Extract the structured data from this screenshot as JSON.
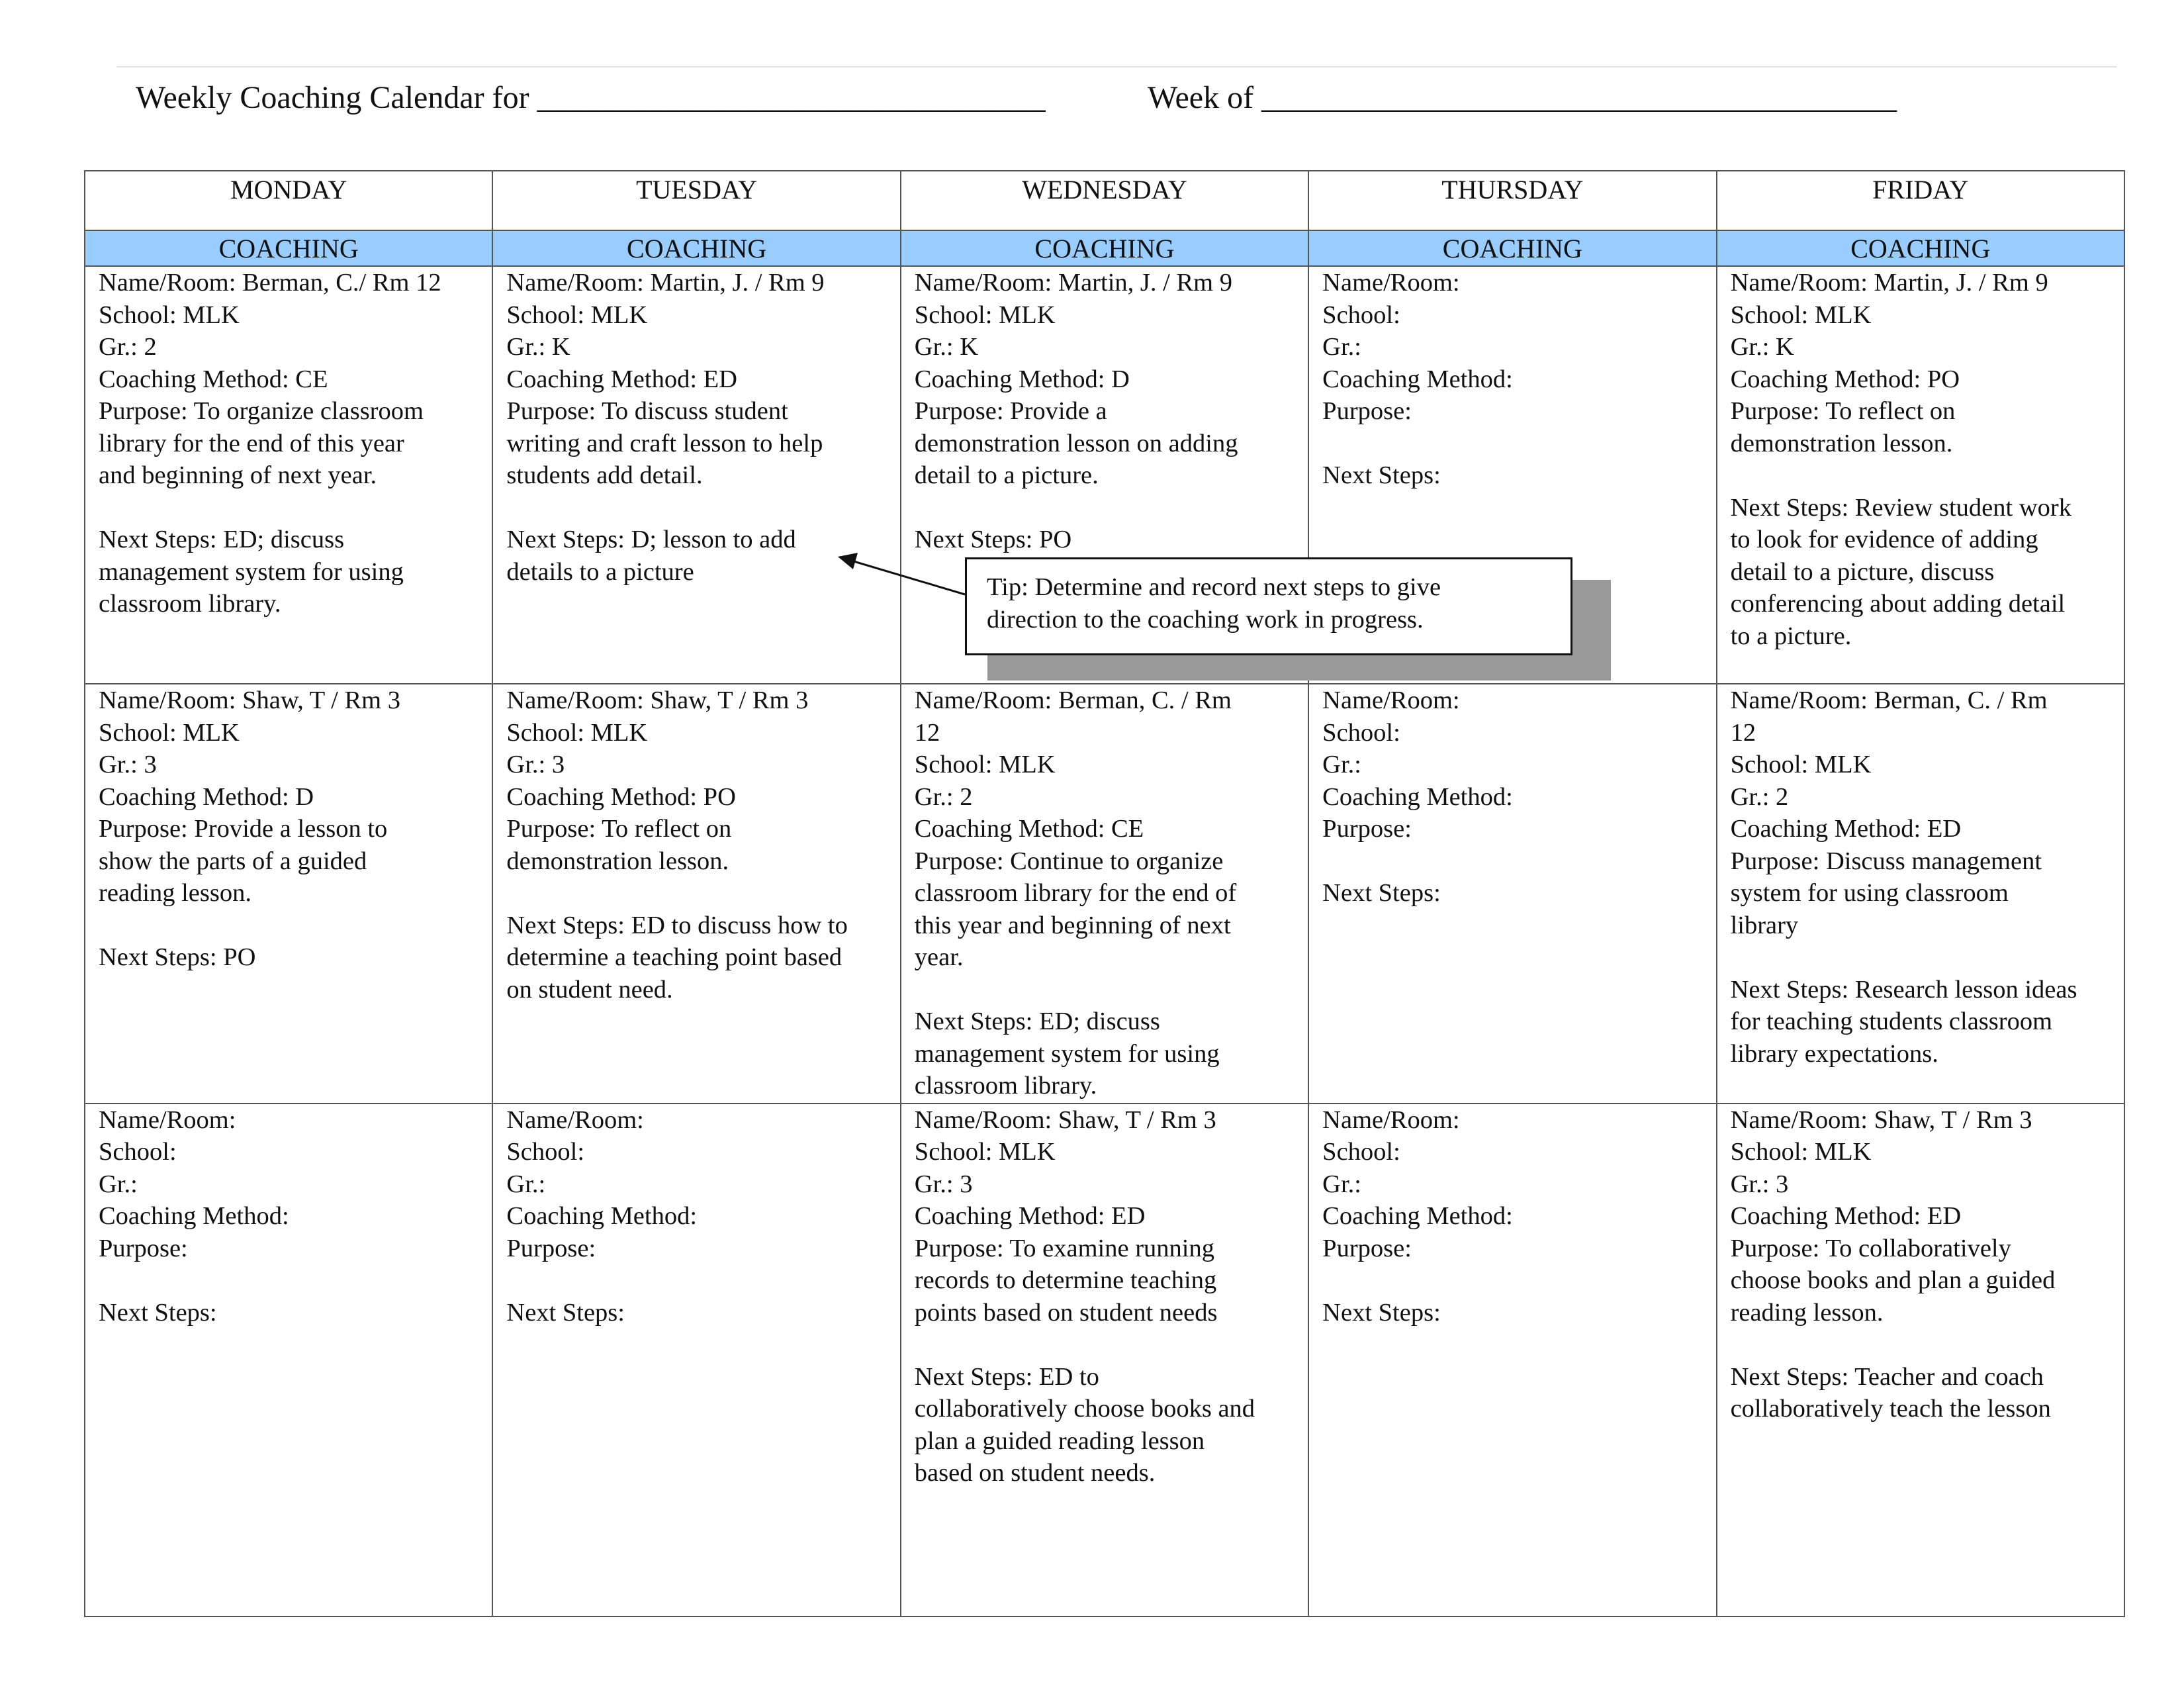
{
  "header": {
    "title_label": "Weekly Coaching Calendar for ________________________________",
    "week_label": "Week of ________________________________________"
  },
  "days": [
    "MONDAY",
    "TUESDAY",
    "WEDNESDAY",
    "THURSDAY",
    "FRIDAY"
  ],
  "section_label": "COACHING",
  "rows": [
    [
      {
        "name_room": "Name/Room: Berman, C./ Rm 12",
        "school": "School: MLK",
        "grade": "Gr.:  2",
        "method": "Coaching Method:  CE",
        "purpose": [
          "Purpose:  To organize classroom",
          "library for the end of this year",
          "and beginning of next year."
        ],
        "next_steps": [
          "Next Steps: ED; discuss",
          "management system for using",
          "classroom library."
        ]
      },
      {
        "name_room": "Name/Room: Martin, J. / Rm 9",
        "school": "School: MLK",
        "grade": "Gr.:  K",
        "method": "Coaching Method: ED",
        "purpose": [
          "Purpose: To discuss student",
          "writing and craft lesson to help",
          "students add detail."
        ],
        "next_steps": [
          "Next Steps: D; lesson to add",
          "details to a picture"
        ]
      },
      {
        "name_room": "Name/Room: Martin, J. / Rm 9",
        "school": "School: MLK",
        "grade": "Gr.:  K",
        "method": "Coaching Method:  D",
        "purpose": [
          "Purpose:  Provide a",
          "demonstration lesson on adding",
          "detail to a picture."
        ],
        "next_steps": [
          "Next Steps: PO"
        ]
      },
      {
        "name_room": "Name/Room:",
        "school": "School:",
        "grade": "Gr.:",
        "method": "Coaching Method:",
        "purpose": [
          "Purpose:"
        ],
        "next_steps": [
          "Next Steps:"
        ]
      },
      {
        "name_room": "Name/Room: Martin, J. / Rm 9",
        "school": "School: MLK",
        "grade": "Gr.:  K",
        "method": "Coaching Method: PO",
        "purpose": [
          "Purpose: To reflect on",
          "demonstration lesson."
        ],
        "next_steps": [
          "Next Steps: Review student work",
          "to look for evidence of adding",
          "detail to a picture, discuss",
          "conferencing about adding detail",
          "to a picture."
        ]
      }
    ],
    [
      {
        "name_room": "Name/Room: Shaw, T / Rm 3",
        "school": "School: MLK",
        "grade": "Gr.:  3",
        "method": "Coaching Method:  D",
        "purpose": [
          "Purpose:  Provide a lesson to",
          "show the parts of a guided",
          "reading lesson."
        ],
        "next_steps": [
          "Next Steps: PO"
        ]
      },
      {
        "name_room": "Name/Room: Shaw, T / Rm 3",
        "school": "School: MLK",
        "grade": "Gr.:  3",
        "method": "Coaching Method: PO",
        "purpose": [
          "Purpose: To reflect on",
          "demonstration lesson."
        ],
        "next_steps": [
          "Next Steps: ED to discuss how to",
          "determine a teaching point based",
          "on student need."
        ]
      },
      {
        "name_room": "Name/Room: Berman, C. / Rm",
        "name_room_cont": "12",
        "school": "School: MLK",
        "grade": "Gr.:  2",
        "method": "Coaching Method:  CE",
        "purpose": [
          "Purpose:  Continue to organize",
          "classroom library for the end of",
          "this year and beginning of next",
          "year."
        ],
        "next_steps": [
          "Next Steps: ED; discuss",
          "management system for using",
          "classroom library."
        ]
      },
      {
        "name_room": "Name/Room:",
        "school": "School:",
        "grade": "Gr.:",
        "method": "Coaching Method:",
        "purpose": [
          "Purpose:"
        ],
        "next_steps": [
          "Next Steps:"
        ]
      },
      {
        "name_room": "Name/Room: Berman, C. / Rm",
        "name_room_cont": "12",
        "school": "School: MLK",
        "grade": "Gr.:  2",
        "method": "Coaching Method:  ED",
        "purpose": [
          "Purpose:  Discuss management",
          "system for using classroom",
          "library"
        ],
        "next_steps": [
          "Next Steps: Research lesson ideas",
          "for teaching students classroom",
          "library expectations."
        ]
      }
    ],
    [
      {
        "name_room": "Name/Room:",
        "school": "School:",
        "grade": "Gr.:",
        "method": "Coaching Method:",
        "purpose": [
          "Purpose:"
        ],
        "next_steps": [
          "Next Steps:"
        ]
      },
      {
        "name_room": "Name/Room:",
        "school": "School:",
        "grade": "Gr.:",
        "method": "Coaching Method:",
        "purpose": [
          "Purpose:"
        ],
        "next_steps": [
          "Next Steps:"
        ]
      },
      {
        "name_room": "Name/Room: Shaw, T / Rm 3",
        "school": "School: MLK",
        "grade": "Gr.:  3",
        "method": "Coaching Method:  ED",
        "purpose": [
          "Purpose:  To examine running",
          "records to determine teaching",
          "points based on student needs"
        ],
        "next_steps": [
          "Next Steps:  ED to",
          "collaboratively choose books and",
          "plan a guided reading lesson",
          "based on student needs."
        ]
      },
      {
        "name_room": "Name/Room:",
        "school": "School:",
        "grade": "Gr.:",
        "method": "Coaching Method:",
        "purpose": [
          "Purpose:"
        ],
        "next_steps": [
          "Next Steps:"
        ]
      },
      {
        "name_room": "Name/Room: Shaw, T / Rm 3",
        "school": "School: MLK",
        "grade": "Gr.:  3",
        "method": "Coaching Method:  ED",
        "purpose": [
          "Purpose:  To collaboratively",
          "choose books and plan a guided",
          "reading lesson."
        ],
        "next_steps": [
          "Next Steps: Teacher and coach",
          "collaboratively teach the lesson"
        ]
      }
    ]
  ],
  "tip": {
    "lines": [
      "Tip: Determine and record next steps to give",
      "direction to the coaching work in progress."
    ]
  },
  "colors": {
    "coaching_band": "#99ccff",
    "border": "#555555",
    "callout_shadow": "#999999"
  }
}
